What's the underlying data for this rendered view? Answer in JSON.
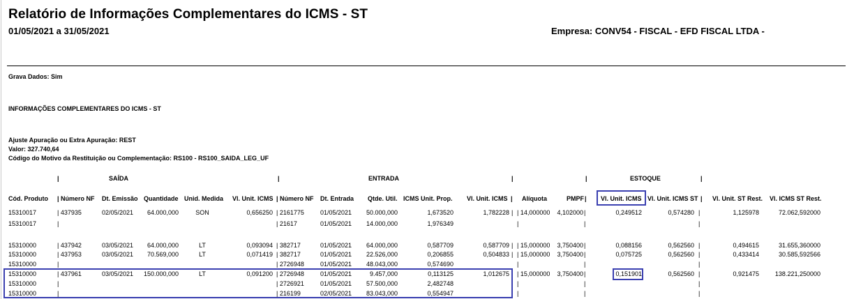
{
  "report": {
    "title": "Relatório de Informações Complementares do ICMS - ST",
    "period": "01/05/2021 a 31/05/2021",
    "company": "Empresa: CONV54 - FISCAL - EFD FISCAL LTDA -",
    "grava_dados": "Grava Dados: Sim",
    "section_title": "INFORMAÇÕES COMPLEMENTARES DO ICMS - ST",
    "ajuste": "Ajuste Apuração ou Extra Apuração: REST",
    "valor": "Valor: 327.740,64",
    "codigo_motivo": "Código do Motivo da Restituição ou Complementação: RS100 - RS100_SAIDA_LEG_UF"
  },
  "groups": {
    "saida": "SAÍDA",
    "entrada": "ENTRADA",
    "estoque": "ESTOQUE"
  },
  "columns": {
    "cod_produto": "Cód. Produto",
    "numero_nf_saida": "Número NF",
    "dt_emissao": "Dt. Emissão",
    "quantidade": "Quantidade",
    "unid_medida": "Unid. Medida",
    "vl_unit_icms_saida": "Vl. Unit. ICMS",
    "numero_nf_entrada": "Número NF",
    "dt_entrada": "Dt. Entrada",
    "qtde_util": "Qtde. Util.",
    "icms_unit_prop": "ICMS Unit. Prop.",
    "vl_unit_icms_entrada": "Vl. Unit. ICMS",
    "aliquota": "Alíquota",
    "pmpf": "PMPF",
    "vl_unit_icms_estoque": "Vl. Unit. ICMS",
    "vl_unit_icms_st": "Vl. Unit. ICMS ST",
    "vl_unit_st_rest": "Vl. Unit. ST Rest.",
    "vl_icms_st_rest": "Vl. ICMS ST Rest."
  },
  "rows": [
    {
      "cod": "15310017",
      "nf_saida": "437935",
      "dt_emissao": "02/05/2021",
      "qtd": "64.000,000",
      "unid": "SON",
      "vl_icms_saida": "0,656250",
      "nf_entrada": "2161775",
      "dt_entrada": "01/05/2021",
      "qtde_util": "50.000,000",
      "icms_prop": "1,673520",
      "vl_icms_entrada": "1,782228",
      "aliquota": "14,000000",
      "pmpf": "4,102000",
      "vl_icms_estoque": "0,249512",
      "vl_icms_st": "0,574280",
      "vl_st_rest": "1,125978",
      "vl_icms_st_rest": "72.062,592000"
    },
    {
      "cod": "15310017",
      "nf_saida": "",
      "dt_emissao": "",
      "qtd": "",
      "unid": "",
      "vl_icms_saida": "",
      "nf_entrada": "21617",
      "dt_entrada": "01/05/2021",
      "qtde_util": "14.000,000",
      "icms_prop": "1,976349",
      "vl_icms_entrada": "",
      "aliquota": "",
      "pmpf": "",
      "vl_icms_estoque": "",
      "vl_icms_st": "",
      "vl_st_rest": "",
      "vl_icms_st_rest": ""
    },
    {
      "cod": "15310000",
      "nf_saida": "437942",
      "dt_emissao": "03/05/2021",
      "qtd": "64.000,000",
      "unid": "LT",
      "vl_icms_saida": "0,093094",
      "nf_entrada": "382717",
      "dt_entrada": "01/05/2021",
      "qtde_util": "64.000,000",
      "icms_prop": "0,587709",
      "vl_icms_entrada": "0,587709",
      "aliquota": "15,000000",
      "pmpf": "3,750400",
      "vl_icms_estoque": "0,088156",
      "vl_icms_st": "0,562560",
      "vl_st_rest": "0,494615",
      "vl_icms_st_rest": "31.655,360000"
    },
    {
      "cod": "15310000",
      "nf_saida": "437953",
      "dt_emissao": "03/05/2021",
      "qtd": "70.569,000",
      "unid": "LT",
      "vl_icms_saida": "0,071419",
      "nf_entrada": "382717",
      "dt_entrada": "01/05/2021",
      "qtde_util": "22.526,000",
      "icms_prop": "0,206855",
      "vl_icms_entrada": "0,504833",
      "aliquota": "15,000000",
      "pmpf": "3,750400",
      "vl_icms_estoque": "0,075725",
      "vl_icms_st": "0,562560",
      "vl_st_rest": "0,433414",
      "vl_icms_st_rest": "30.585,592566"
    },
    {
      "cod": "15310000",
      "nf_saida": "",
      "dt_emissao": "",
      "qtd": "",
      "unid": "",
      "vl_icms_saida": "",
      "nf_entrada": "2726948",
      "dt_entrada": "01/05/2021",
      "qtde_util": "48.043,000",
      "icms_prop": "0,574690",
      "vl_icms_entrada": "",
      "aliquota": "",
      "pmpf": "",
      "vl_icms_estoque": "",
      "vl_icms_st": "",
      "vl_st_rest": "",
      "vl_icms_st_rest": ""
    },
    {
      "cod": "15310000",
      "nf_saida": "437961",
      "dt_emissao": "03/05/2021",
      "qtd": "150.000,000",
      "unid": "LT",
      "vl_icms_saida": "0,091200",
      "nf_entrada": "2726948",
      "dt_entrada": "01/05/2021",
      "qtde_util": "9.457,000",
      "icms_prop": "0,113125",
      "vl_icms_entrada": "1,012675",
      "aliquota": "15,000000",
      "pmpf": "3,750400",
      "vl_icms_estoque": "0,151901",
      "vl_icms_st": "0,562560",
      "vl_st_rest": "0,921475",
      "vl_icms_st_rest": "138.221,250000"
    },
    {
      "cod": "15310000",
      "nf_saida": "",
      "dt_emissao": "",
      "qtd": "",
      "unid": "",
      "vl_icms_saida": "",
      "nf_entrada": "2726921",
      "dt_entrada": "01/05/2021",
      "qtde_util": "57.500,000",
      "icms_prop": "2,482748",
      "vl_icms_entrada": "",
      "aliquota": "",
      "pmpf": "",
      "vl_icms_estoque": "",
      "vl_icms_st": "",
      "vl_st_rest": "",
      "vl_icms_st_rest": ""
    },
    {
      "cod": "15310000",
      "nf_saida": "",
      "dt_emissao": "",
      "qtd": "",
      "unid": "",
      "vl_icms_saida": "",
      "nf_entrada": "216199",
      "dt_entrada": "02/05/2021",
      "qtde_util": "83.043,000",
      "icms_prop": "0,554947",
      "vl_icms_entrada": "",
      "aliquota": "",
      "pmpf": "",
      "vl_icms_estoque": "",
      "vl_icms_st": "",
      "vl_st_rest": "",
      "vl_icms_st_rest": ""
    }
  ],
  "colors": {
    "highlight_box": "#3a3fb0"
  }
}
